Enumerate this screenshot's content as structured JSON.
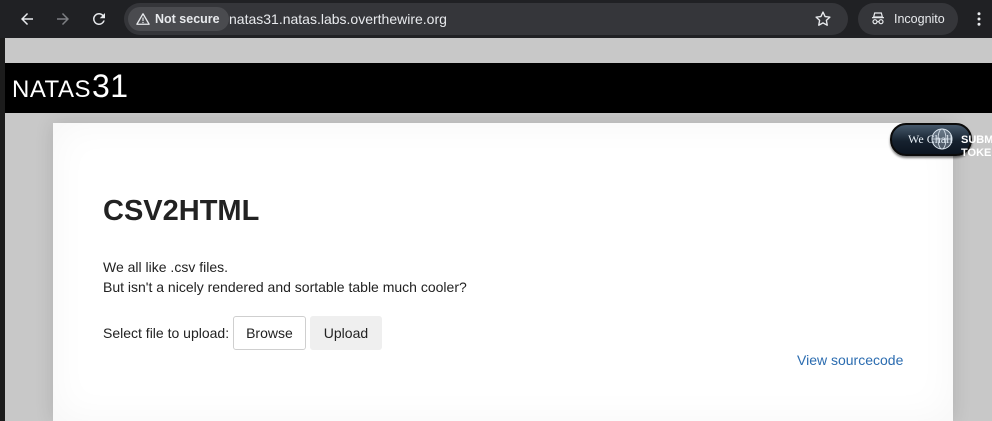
{
  "browser": {
    "security_label": "Not secure",
    "url": "natas31.natas.labs.overthewire.org",
    "profile_label": "Incognito"
  },
  "site": {
    "title_prefix": "NATAS",
    "title_number": "31"
  },
  "content": {
    "heading": "CSV2HTML",
    "line1": "We all like .csv files.",
    "line2": "But isn't a nicely rendered and sortable table much cooler?",
    "upload_label": "Select file to upload:",
    "browse_label": "Browse",
    "upload_button": "Upload",
    "source_link": "View sourcecode"
  },
  "wechall": {
    "badge_text": "We Chall",
    "submit_line1": "SUBM",
    "submit_line2": "TOKE"
  },
  "colors": {
    "chrome_bg": "#202124",
    "header_bg": "#000000",
    "link": "#2b6cb0"
  }
}
